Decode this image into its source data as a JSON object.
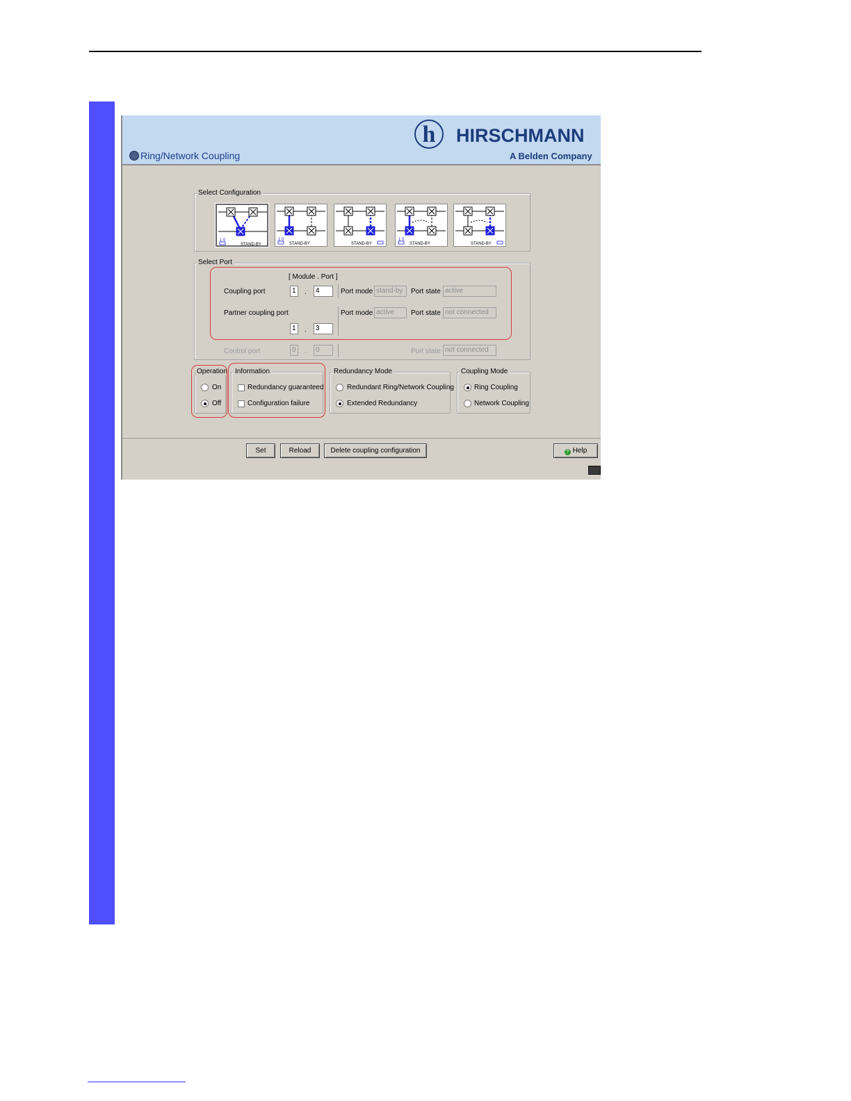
{
  "app": {
    "title": "Ring/Network Coupling",
    "brand_name": "HIRSCHMANN",
    "brand_sub": "A Belden Company",
    "logo_glyph": "h"
  },
  "select_configuration": {
    "legend": "Select Configuration",
    "tiles": [
      {
        "caption": "STAND-BY",
        "indicator": "1 0",
        "selected": true
      },
      {
        "caption": "STAND-BY",
        "indicator": "1 0",
        "selected": false
      },
      {
        "caption": "STAND-BY",
        "indicator": "",
        "selected": false
      },
      {
        "caption": "STAND-BY",
        "indicator": "1 0",
        "selected": false
      },
      {
        "caption": "STAND-BY",
        "indicator": "",
        "selected": false
      }
    ]
  },
  "select_port": {
    "legend": "Select Port",
    "module_port_header": "[ Module . Port ]",
    "coupling_port": {
      "label": "Coupling port",
      "module": "1",
      "port": "4",
      "port_mode_label": "Port mode",
      "port_mode": "stand-by",
      "port_state_label": "Port state",
      "port_state": "active"
    },
    "partner_coupling_port": {
      "label": "Partner coupling port",
      "module": "1",
      "port": "3",
      "port_mode_label": "Port mode",
      "port_mode": "active",
      "port_state_label": "Port state",
      "port_state": "not connected"
    },
    "control_port": {
      "label": "Control port",
      "module": "0",
      "port": "0",
      "port_state_label": "Port state",
      "port_state": "not connected"
    },
    "dot": "."
  },
  "operation": {
    "legend": "Operation",
    "options": [
      {
        "label": "On",
        "selected": false
      },
      {
        "label": "Off",
        "selected": true
      }
    ]
  },
  "information": {
    "legend": "Information",
    "items": [
      {
        "label": "Redundancy guaranteed",
        "checked": false
      },
      {
        "label": "Configuration failure",
        "checked": false
      }
    ]
  },
  "redundancy_mode": {
    "legend": "Redundancy Mode",
    "options": [
      {
        "label": "Redundant Ring/Network Coupling",
        "selected": false
      },
      {
        "label": "Extended Redundancy",
        "selected": true
      }
    ]
  },
  "coupling_mode": {
    "legend": "Coupling Mode",
    "options": [
      {
        "label": "Ring Coupling",
        "selected": true
      },
      {
        "label": "Network Coupling",
        "selected": false
      }
    ]
  },
  "buttons": {
    "set": "Set",
    "reload": "Reload",
    "delete": "Delete coupling configuration",
    "help": "Help"
  },
  "colors": {
    "page_side_bar": "#4f4fff",
    "panel_bg": "#d4d0c8",
    "banner_bg": "#c3d9f0",
    "brand": "#1c3c7c",
    "highlight": "#d43c3c",
    "switch_active": "#1f1fdc"
  }
}
